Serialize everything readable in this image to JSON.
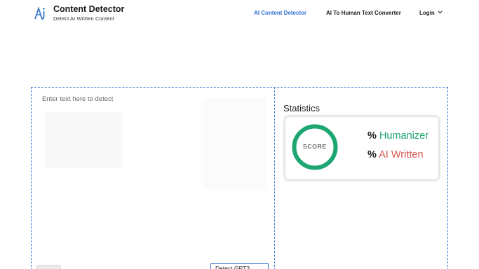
{
  "brand": {
    "name": "Content Detector",
    "tagline": "Detect AI Written Content",
    "logo_icon": "ai-logo-icon"
  },
  "nav": {
    "items": [
      {
        "label": "AI Content Detector",
        "active": true
      },
      {
        "label": "AI To Human Text Converter",
        "active": false
      },
      {
        "label": "Login",
        "active": false
      }
    ],
    "login_icon": "chevron-down-icon"
  },
  "editor": {
    "placeholder": "Enter text here to detect",
    "value": "",
    "detect_button_label": "Detect GPT3"
  },
  "statistics": {
    "title": "Statistics",
    "score_label": "SCORE",
    "percent_symbol": "%",
    "humanizer_label": "Humanizer",
    "ai_written_label": "AI Written"
  },
  "colors": {
    "accent": "#2f6fd6",
    "frame_border": "#3a78c9",
    "score_ring": "#1ea672",
    "humanizer": "#1aa36a",
    "ai_written": "#d9534f"
  }
}
